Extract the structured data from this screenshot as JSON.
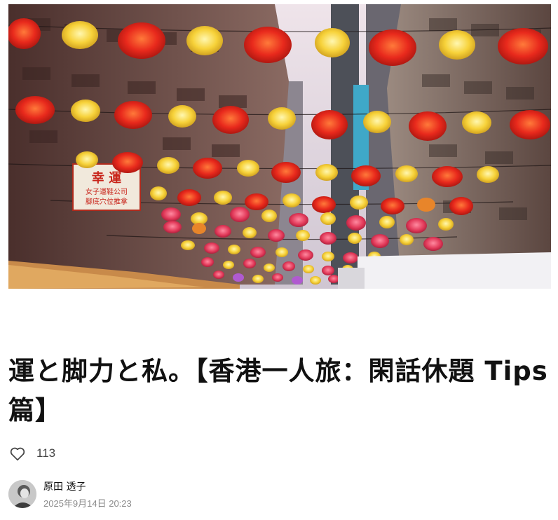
{
  "hero": {
    "sign_title": "幸 運",
    "sign_line1": "女子運鞋公司",
    "sign_line2": "腳底穴位推拿"
  },
  "article": {
    "title": "運と脚力と私。【香港一人旅：閑話休題 Tips篇】"
  },
  "likes": {
    "icon": "heart-outline-icon",
    "count": "113"
  },
  "author": {
    "name": "原田 透子",
    "date": "2025年9月14日 20:23"
  },
  "colors": {
    "lantern_red": "#e8291c",
    "lantern_yellow": "#f7d23a",
    "sky": "#e6dbe3",
    "text": "#111111",
    "muted": "#8a8a8a"
  }
}
